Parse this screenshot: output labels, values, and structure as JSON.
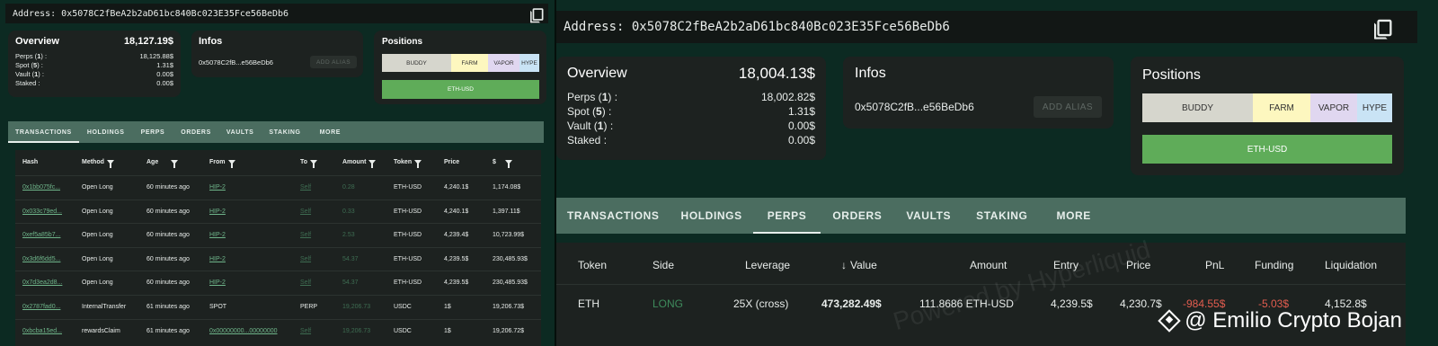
{
  "left": {
    "address": "Address: 0x5078C2fBeA2b2aD61bc840Bc023E35Fce56BeDb6",
    "overview": {
      "title": "Overview",
      "total": "18,127.19$",
      "rows": [
        {
          "label_pre": "Perps (",
          "count": "1",
          "label_post": ") :",
          "value": "18,125.88$"
        },
        {
          "label_pre": "Spot (",
          "count": "5",
          "label_post": ") :",
          "value": "1.31$"
        },
        {
          "label_pre": "Vault (",
          "count": "1",
          "label_post": ") :",
          "value": "0.00$"
        },
        {
          "label_pre": "Staked :",
          "count": "",
          "label_post": "",
          "value": "0.00$"
        }
      ]
    },
    "infos": {
      "title": "Infos",
      "address_short": "0x5078C2fB...e56BeDb6",
      "alias_button": "ADD ALIAS"
    },
    "positions": {
      "title": "Positions",
      "segments": [
        "BUDDY",
        "FARM",
        "VAPOR",
        "HYPE"
      ],
      "eth_bar": "ETH-USD"
    },
    "tabs": [
      "TRANSACTIONS",
      "HOLDINGS",
      "PERPS",
      "ORDERS",
      "VAULTS",
      "STAKING",
      "MORE"
    ],
    "active_tab": "TRANSACTIONS",
    "columns": [
      "Hash",
      "Method",
      "Age",
      "From",
      "To",
      "Amount",
      "Token",
      "Price",
      "$"
    ],
    "rows": [
      {
        "hash": "0x1bb075fc...",
        "method": "Open Long",
        "age": "60 minutes ago",
        "from": "HIP-2",
        "to": "Self",
        "amount": "0.28",
        "token": "ETH-USD",
        "price": "4,240.1$",
        "usd": "1,174.08$"
      },
      {
        "hash": "0x033c79ed...",
        "method": "Open Long",
        "age": "60 minutes ago",
        "from": "HIP-2",
        "to": "Self",
        "amount": "0.33",
        "token": "ETH-USD",
        "price": "4,240.1$",
        "usd": "1,397.11$"
      },
      {
        "hash": "0xef5a85b7...",
        "method": "Open Long",
        "age": "60 minutes ago",
        "from": "HIP-2",
        "to": "Self",
        "amount": "2.53",
        "token": "ETH-USD",
        "price": "4,239.4$",
        "usd": "10,723.99$"
      },
      {
        "hash": "0x3d6f6dd5...",
        "method": "Open Long",
        "age": "60 minutes ago",
        "from": "HIP-2",
        "to": "Self",
        "amount": "54.37",
        "token": "ETH-USD",
        "price": "4,239.5$",
        "usd": "230,485.93$"
      },
      {
        "hash": "0x7d3ea2d8...",
        "method": "Open Long",
        "age": "60 minutes ago",
        "from": "HIP-2",
        "to": "Self",
        "amount": "54.37",
        "token": "ETH-USD",
        "price": "4,239.5$",
        "usd": "230,485.93$"
      },
      {
        "hash": "0x2787fad0...",
        "method": "InternalTransfer",
        "age": "61 minutes ago",
        "from": "SPOT",
        "to": "PERP",
        "amount": "19,206.73",
        "token": "USDC",
        "price": "1$",
        "usd": "19,206.73$"
      },
      {
        "hash": "0xbcba15ed...",
        "method": "rewardsClaim",
        "age": "61 minutes ago",
        "from": "0x00000000...00000000",
        "to": "Self",
        "amount": "19,206.73",
        "token": "USDC",
        "price": "1$",
        "usd": "19,206.72$"
      }
    ]
  },
  "right": {
    "address": "Address: 0x5078C2fBeA2b2aD61bc840Bc023E35Fce56BeDb6",
    "overview": {
      "title": "Overview",
      "total": "18,004.13$",
      "rows": [
        {
          "label_pre": "Perps (",
          "count": "1",
          "label_post": ") :",
          "value": "18,002.82$"
        },
        {
          "label_pre": "Spot (",
          "count": "5",
          "label_post": ") :",
          "value": "1.31$"
        },
        {
          "label_pre": "Vault (",
          "count": "1",
          "label_post": ") :",
          "value": "0.00$"
        },
        {
          "label_pre": "Staked :",
          "count": "",
          "label_post": "",
          "value": "0.00$"
        }
      ]
    },
    "infos": {
      "title": "Infos",
      "address_short": "0x5078C2fB...e56BeDb6",
      "alias_button": "ADD ALIAS"
    },
    "positions": {
      "title": "Positions",
      "segments": [
        "BUDDY",
        "FARM",
        "VAPOR",
        "HYPE"
      ],
      "eth_bar": "ETH-USD"
    },
    "tabs": [
      "TRANSACTIONS",
      "HOLDINGS",
      "PERPS",
      "ORDERS",
      "VAULTS",
      "STAKING",
      "MORE"
    ],
    "active_tab": "PERPS",
    "columns": [
      "Token",
      "Side",
      "Leverage",
      "Value",
      "Amount",
      "Entry",
      "Price",
      "PnL",
      "Funding",
      "Liquidation"
    ],
    "row": {
      "token": "ETH",
      "side": "LONG",
      "leverage": "25X (cross)",
      "value": "473,282.49$",
      "amount": "111.8686 ETH-USD",
      "entry": "4,239.5$",
      "price": "4,230.7$",
      "pnl": "-984.55$",
      "funding": "-5.03$",
      "liquidation": "4,152.8$"
    },
    "watermark": "Powered by Hyperliquid",
    "credit": "@ Emilio Crypto Bojan"
  },
  "colors": {
    "background": "#0c2a22",
    "card": "#1d2220",
    "tabbar": "#4b6d60",
    "eth_bar": "#5fac59",
    "long_green": "#3e8b5c",
    "loss_red": "#e35d4f",
    "segments": [
      "#d6d6cd",
      "#fdf7bf",
      "#e0d7f0",
      "#c9e3f5"
    ]
  }
}
